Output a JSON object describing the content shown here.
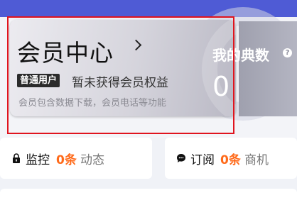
{
  "member_card": {
    "title": "会员中心",
    "tag": "普通用户",
    "status": "暂未获得会员权益",
    "description": "会员包含数据下载，会员电话等功能"
  },
  "my_dian": {
    "label": "我的典数",
    "help": "?",
    "count": "0"
  },
  "monitor": {
    "label": "监控",
    "count": "0条",
    "sub": "动态"
  },
  "subscribe": {
    "label": "订阅",
    "count": "0条",
    "sub": "商机"
  },
  "colors": {
    "accent": "#ff6a1a",
    "highlight": "#e0141e",
    "top_bar": "#4f5bd5"
  }
}
